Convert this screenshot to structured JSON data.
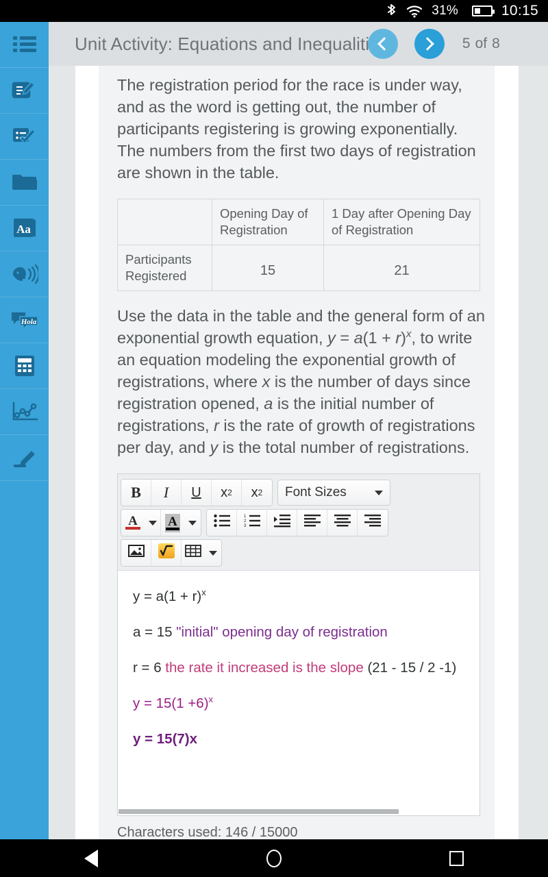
{
  "statusbar": {
    "bluetooth_icon": "bluetooth-icon",
    "wifi_icon": "wifi-icon",
    "battery_percent": "31%",
    "battery_icon": "battery-icon",
    "clock": "10:15"
  },
  "sidebar": {
    "items": [
      {
        "icon": "list-menu-icon",
        "label": "Table of Contents"
      },
      {
        "icon": "notes-pencil-icon",
        "label": "Notes"
      },
      {
        "icon": "checklist-icon",
        "label": "Assignments"
      },
      {
        "icon": "folder-icon",
        "label": "Resources"
      },
      {
        "icon": "glossary-aa-icon",
        "label": "Glossary"
      },
      {
        "icon": "text-to-speech-icon",
        "label": "Read Aloud"
      },
      {
        "icon": "translate-hola-icon",
        "label": "Translate"
      },
      {
        "icon": "calculator-icon",
        "label": "Calculator"
      },
      {
        "icon": "graphing-icon",
        "label": "Graphing Tool"
      },
      {
        "icon": "highlighter-icon",
        "label": "Highlighter"
      }
    ]
  },
  "header": {
    "title": "Unit Activity: Equations and Inequalities",
    "prev_icon": "chevron-left-icon",
    "next_icon": "chevron-right-icon",
    "page_current": "5",
    "page_of": "of",
    "page_total": "8",
    "accent_color": "#2a9fd8"
  },
  "content": {
    "intro_paragraph": "The registration period for the race is under way, and as the word is getting out, the number of participants registering is growing exponentially. The numbers from the first two days of registration are shown in the table.",
    "table": {
      "corner_header": "",
      "column_headers": [
        "Opening Day of Registration",
        "1 Day after Opening Day of Registration"
      ],
      "row_label": "Participants Registered",
      "row_values": [
        "15",
        "21"
      ]
    },
    "task_paragraph": {
      "p1": "Use the data in the table and the general form of an exponential growth equation, ",
      "eq_y": "y",
      "eq_eq": " = ",
      "eq_a": "a",
      "eq_open": "(1 + ",
      "eq_r": "r",
      "eq_close": ")",
      "eq_exp": "x",
      "p2": ", to write an equation modeling the exponential growth of registrations, where ",
      "var_x": "x",
      "p3": " is the number of days since registration opened, ",
      "var_a": "a",
      "p4": " is the initial number of registrations, ",
      "var_r": "r",
      "p5": " is the rate of growth of registrations per day, and ",
      "var_y": "y",
      "p6": " is the total number of registrations."
    }
  },
  "editor": {
    "toolbar": {
      "bold": "B",
      "italic": "I",
      "underline": "U",
      "superscript_base": "x",
      "superscript_exp": "2",
      "subscript_base": "x",
      "subscript_exp": "2",
      "font_sizes_label": "Font Sizes",
      "font_sizes_caret_icon": "chevron-down-icon",
      "text_color_icon": "text-color-a-icon",
      "text_color_caret_icon": "chevron-down-icon",
      "highlight_color_icon": "highlight-color-a-icon",
      "highlight_color_caret_icon": "chevron-down-icon",
      "bullet_list_icon": "bullet-list-icon",
      "numbered_list_icon": "numbered-list-icon",
      "indent_icon": "indent-icon",
      "align_left_icon": "align-left-icon",
      "align_center_icon": "align-center-icon",
      "align_right_icon": "align-right-icon",
      "insert_image_icon": "insert-image-icon",
      "equation_icon": "square-root-equation-icon",
      "insert_table_icon": "insert-table-icon",
      "insert_table_caret_icon": "chevron-down-icon"
    },
    "answer": {
      "line1_a": "y = a(1 + r)",
      "line1_exp": "x",
      "line2_a": "a = 15 ",
      "line2_b": "\"initial\" opening day of registration",
      "line3_a": "r = 6 ",
      "line3_b": "the rate it increased is the slope",
      "line3_c": " (21 - 15 / 2 -1)",
      "line4_a": "y = 15(1 +6)",
      "line4_exp": "x",
      "line5": "y = 15(7)x"
    },
    "colors": {
      "magenta": "#9b1f85",
      "pink": "#c13b7a",
      "bold_purple": "#6d1f7a",
      "body_text": "#2f3234"
    },
    "char_count": "Characters used: 146 / 15000",
    "hscrollbar_icon": "horizontal-scrollbar"
  },
  "navbar": {
    "back_icon": "android-back-icon",
    "home_icon": "android-home-icon",
    "recents_icon": "android-recents-icon"
  }
}
